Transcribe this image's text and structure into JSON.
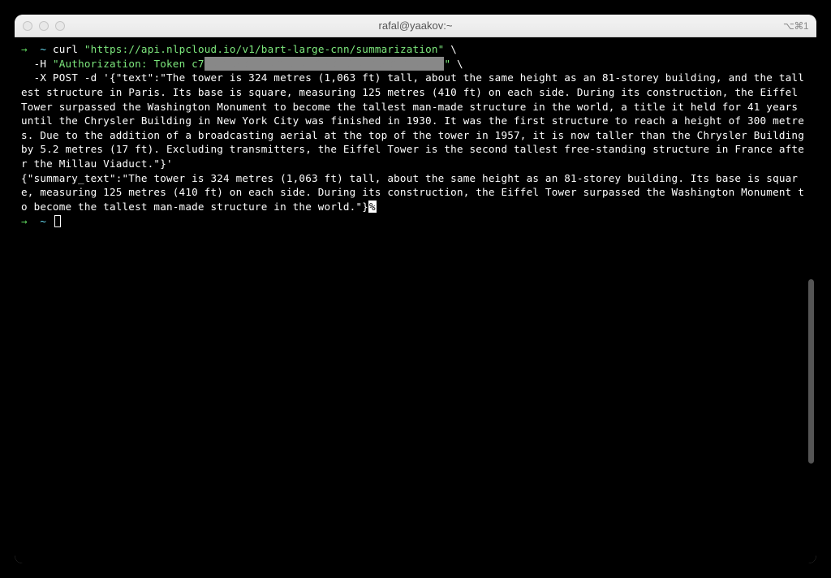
{
  "window": {
    "title": "rafal@yaakov:~",
    "shortcut": "⌘1",
    "shortcut_prefix": "⌥"
  },
  "terminal": {
    "prompt_arrow": "→",
    "prompt_path": "~",
    "command1_part1": "curl ",
    "command1_url": "\"https://api.nlpcloud.io/v1/bart-large-cnn/summarization\"",
    "command1_cont": " \\",
    "command2_prefix": "  -H ",
    "command2_header_start": "\"Authorization: Token c7",
    "command2_header_end": "\"",
    "command2_cont": " \\",
    "command3": "  -X POST -d '{\"text\":\"The tower is 324 metres (1,063 ft) tall, about the same height as an 81-storey building, and the tallest structure in Paris. Its base is square, measuring 125 metres (410 ft) on each side. During its construction, the Eiffel Tower surpassed the Washington Monument to become the tallest man-made structure in the world, a title it held for 41 years until the Chrysler Building in New York City was finished in 1930. It was the first structure to reach a height of 300 metres. Due to the addition of a broadcasting aerial at the top of the tower in 1957, it is now taller than the Chrysler Building by 5.2 metres (17 ft). Excluding transmitters, the Eiffel Tower is the second tallest free-standing structure in France after the Millau Viaduct.\"}'",
    "response": "{\"summary_text\":\"The tower is 324 metres (1,063 ft) tall, about the same height as an 81-storey building. Its base is square, measuring 125 metres (410 ft) on each side. During its construction, the Eiffel Tower surpassed the Washington Monument to become the tallest man-made structure in the world.\"}",
    "percent": "%"
  }
}
